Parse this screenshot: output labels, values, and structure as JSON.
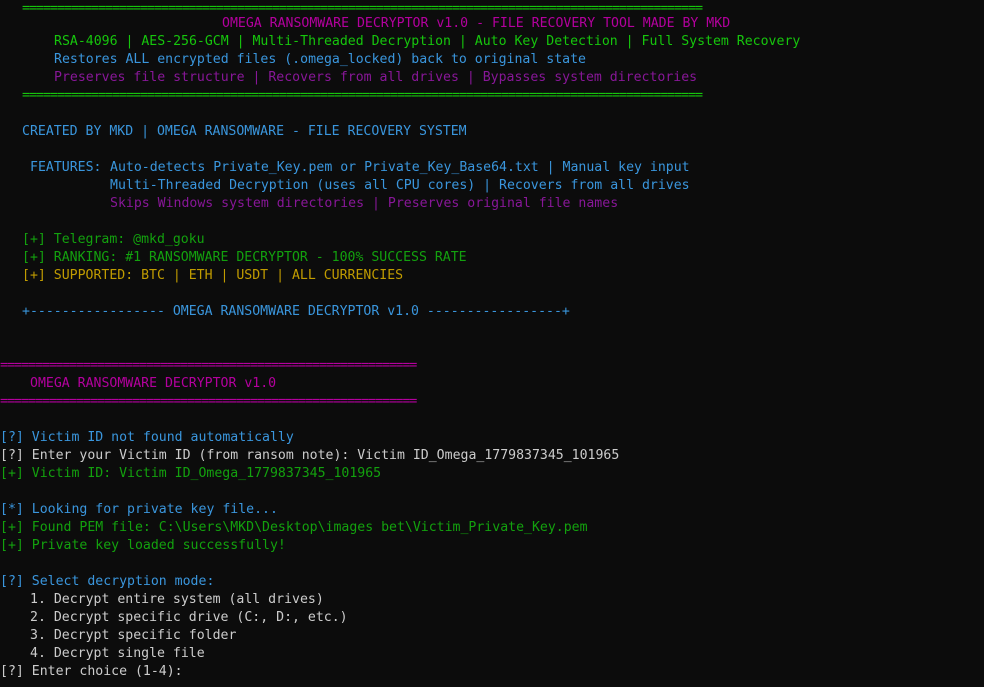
{
  "colors": {
    "background": "#0c0c0c",
    "green": "#16c60c",
    "dark_green": "#13a10e",
    "blue": "#3a96dd",
    "magenta": "#b4009e",
    "purple": "#881798",
    "yellow": "#c19c00",
    "white": "#cccccc"
  },
  "banner": {
    "rule": "==================================================================================================",
    "title": "OMEGA RANSOMWARE DECRYPTOR v1.0 - FILE RECOVERY TOOL MADE BY MKD",
    "line1": "RSA-4096 | AES-256-GCM | Multi-Threaded Decryption | Auto Key Detection | Full System Recovery",
    "line2": "Restores ALL encrypted files (.omega_locked) back to original state",
    "line3": "Preserves file structure | Recovers from all drives | Bypasses system directories"
  },
  "created_by": "CREATED BY MKD | OMEGA RANSOMWARE - FILE RECOVERY SYSTEM",
  "features": {
    "label": "FEATURES:",
    "line1": "Auto-detects Private_Key.pem or Private_Key_Base64.txt | Manual key input",
    "line2": "Multi-Threaded Decryption (uses all CPU cores) | Recovers from all drives",
    "line3": "Skips Windows system directories | Preserves original file names"
  },
  "info": {
    "telegram": "[+] Telegram: @mkd_goku",
    "ranking": "[+] RANKING: #1 RANSOMWARE DECRYPTOR - 100% SUCCESS RATE",
    "supported": "[+] SUPPORTED: BTC | ETH | USDT | ALL CURRENCIES"
  },
  "divider": "+----------------- OMEGA RANSOMWARE DECRYPTOR v1.0 -----------------+",
  "section": {
    "rule": "============================================================",
    "title": "OMEGA RANSOMWARE DECRYPTOR v1.0"
  },
  "log": {
    "victim_not_found_tag": "[?]",
    "victim_not_found": " Victim ID not found automatically",
    "enter_victim_tag": "[?]",
    "enter_victim": " Enter your Victim ID (from ransom note): Victim ID_Omega_1779837345_101965",
    "victim_id": "[+] Victim ID: Victim ID_Omega_1779837345_101965",
    "looking_tag": "[*]",
    "looking": " Looking for private key file...",
    "found_pem": "[+] Found PEM file: C:\\Users\\MKD\\Desktop\\images bet\\Victim_Private_Key.pem",
    "key_loaded": "[+] Private key loaded successfully!",
    "select_tag": "[?]",
    "select": " Select decryption mode:",
    "opt1": "1. Decrypt entire system (all drives)",
    "opt2": "2. Decrypt specific drive (C:, D:, etc.)",
    "opt3": "3. Decrypt specific folder",
    "opt4": "4. Decrypt single file",
    "enter_choice_tag": "[?]",
    "enter_choice": " Enter choice (1-4):"
  }
}
